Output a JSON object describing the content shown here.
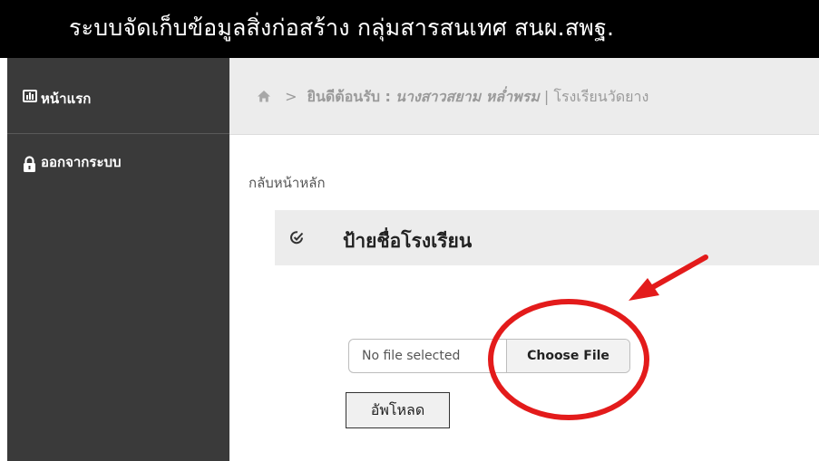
{
  "header": {
    "app_title": "ระบบจัดเก็บข้อมูลสิ่งก่อสร้าง กลุ่มสารสนเทศ สนผ.สพฐ."
  },
  "sidebar": {
    "items": [
      {
        "label": "หน้าแรก",
        "icon": "bar-chart-icon"
      },
      {
        "label": "ออกจากระบบ",
        "icon": "lock-icon"
      }
    ]
  },
  "breadcrumb": {
    "separator": ">",
    "welcome_label": "ยินดีต้อนรับ :",
    "user_name": "นางสาวสยาม  หล่ำพรม",
    "school": "| โรงเรียนวัดยาง"
  },
  "main": {
    "back_link": "กลับหน้าหลัก",
    "panel_title": "ป้ายชื่อโรงเรียน",
    "file_input": {
      "status": "No file selected",
      "button_label": "Choose File"
    },
    "upload_label": "อัพโหลด"
  },
  "colors": {
    "header_bg": "#000000",
    "sidebar_bg": "#3a3a3a",
    "panel_bg": "#ececec",
    "annotation_red": "#e31b1b"
  }
}
